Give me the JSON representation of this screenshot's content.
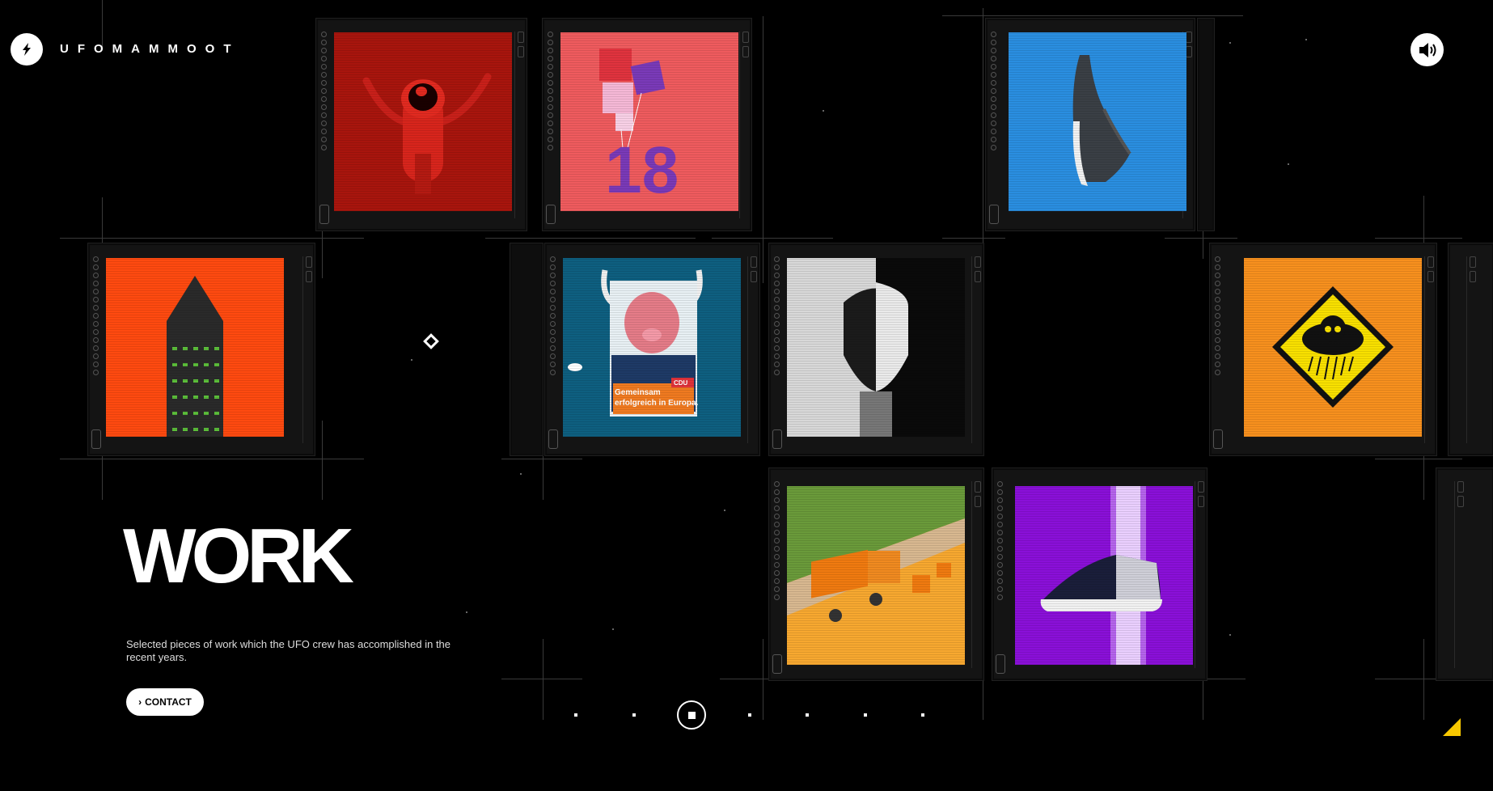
{
  "header": {
    "brand": "UFOMAMMOOT",
    "logo_icon": "lightning-bolt-icon",
    "sound_icon": "speaker-icon"
  },
  "section": {
    "title": "WORK",
    "description": "Selected pieces of work which the UFO crew has accomplished in the recent years.",
    "contact_label": "CONTACT"
  },
  "tiles": [
    {
      "name": "red-creature",
      "color": "#b01a10"
    },
    {
      "name": "balloons-18",
      "color": "#f05a5a",
      "label": "18"
    },
    {
      "name": "grey-sneaker",
      "color": "#2d8fe0"
    },
    {
      "name": "green-tower",
      "color": "#ff4a10"
    },
    {
      "name": "cdu-poster",
      "color": "#0e5f80",
      "poster_text": "Gemeinsam erfolgreich in Europa.",
      "badge": "CDU"
    },
    {
      "name": "split-face",
      "color": "#222222"
    },
    {
      "name": "skull-cloud-sign",
      "color": "#f7901e"
    },
    {
      "name": "orange-delivery-trucks",
      "color": "#f7a830"
    },
    {
      "name": "purple-sneaker",
      "color": "#8a10d8"
    }
  ],
  "pagination": {
    "count": 7,
    "active_index": 2
  }
}
